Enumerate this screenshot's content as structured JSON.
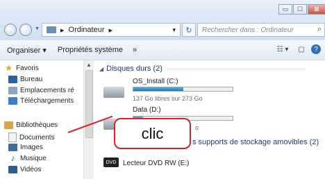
{
  "window": {
    "controls": {
      "minimize": "▭",
      "maximize": "☐",
      "close": "⊠"
    }
  },
  "nav": {
    "address": {
      "arrow1": "▸",
      "segment": "Ordinateur",
      "arrow2": "▸",
      "dropdown": "▾"
    },
    "refresh_glyph": "↻",
    "search_placeholder": "Rechercher dans : Ordinateur",
    "search_icon_glyph": "⌕"
  },
  "toolbar": {
    "organiser": "Organiser ▾",
    "proprietes": "Propriétés système",
    "more": "»",
    "view_glyph": "☷ ▾",
    "pane_glyph": "▢",
    "help_glyph": "?"
  },
  "sidebar": {
    "favoris": "Favoris",
    "bureau": "Bureau",
    "emplacements": "Emplacements ré",
    "telechargements": "Téléchargements",
    "bibliotheques": "Bibliothèques",
    "documents": "Documents",
    "images": "Images",
    "musique": "Musique",
    "videos": "Vidéos"
  },
  "main": {
    "disques_header": "Disques durs (2)",
    "drive_c": {
      "name": "OS_Install (C:)",
      "free": "137 Go libres sur 273 Go",
      "used_fraction": 0.5
    },
    "drive_d": {
      "name": "Data (D:)",
      "free_partial": "o",
      "used_fraction": 0.1
    },
    "removable_header": "s supports de stockage amovibles (2)",
    "dvd": {
      "name": "Lecteur DVD RW (E:)",
      "badge": "DVD"
    }
  },
  "annotation": {
    "label": "clic"
  },
  "colors": {
    "accent": "#1e3a8a",
    "callout": "#e02020",
    "bar_fill": "#1a78c2"
  }
}
